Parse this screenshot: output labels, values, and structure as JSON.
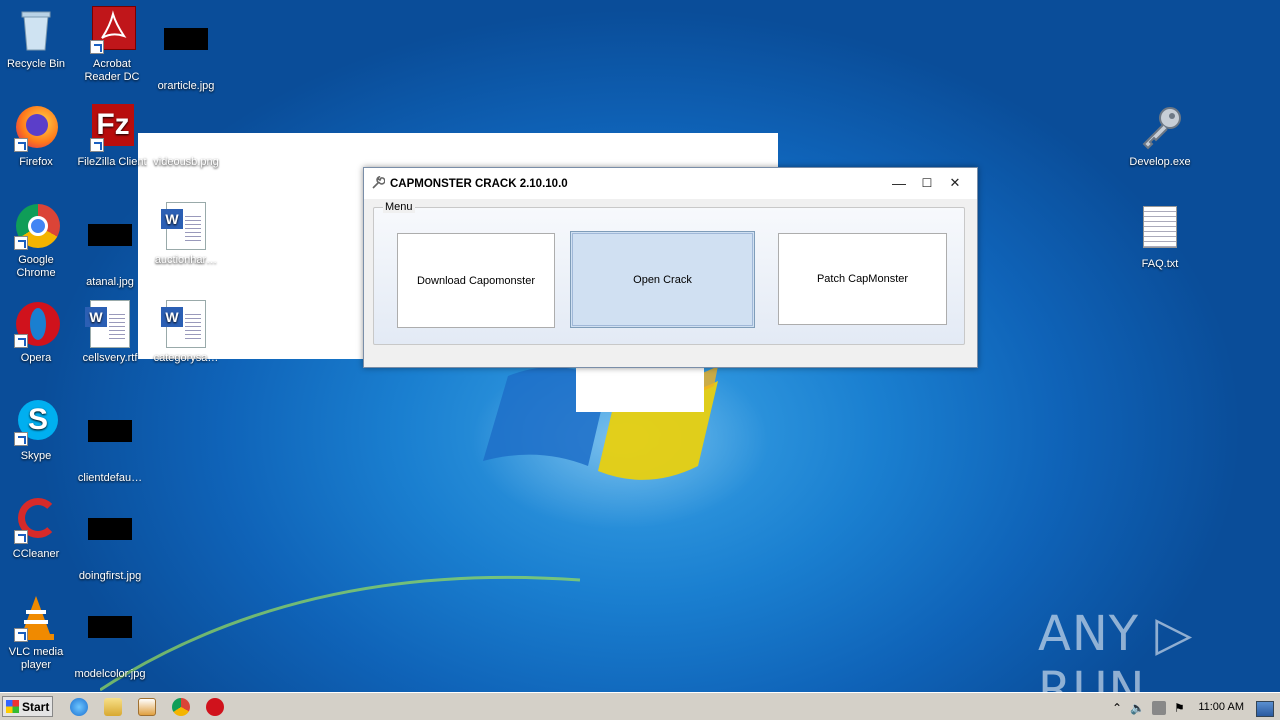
{
  "desktop": {
    "icons": [
      {
        "id": "recycle-bin",
        "label": "Recycle Bin"
      },
      {
        "id": "acrobat",
        "label": "Acrobat Reader DC"
      },
      {
        "id": "orarticle",
        "label": "orarticle.jpg"
      },
      {
        "id": "firefox",
        "label": "Firefox"
      },
      {
        "id": "filezilla",
        "label": "FileZilla Client"
      },
      {
        "id": "videousb",
        "label": "videousb.png"
      },
      {
        "id": "chrome",
        "label": "Google Chrome"
      },
      {
        "id": "atanal",
        "label": "atanal.jpg"
      },
      {
        "id": "auctionhar",
        "label": "auctionhar…"
      },
      {
        "id": "opera",
        "label": "Opera"
      },
      {
        "id": "cellsvery",
        "label": "cellsvery.rtf"
      },
      {
        "id": "categorysa",
        "label": "categorysa…"
      },
      {
        "id": "skype",
        "label": "Skype"
      },
      {
        "id": "clientdefau",
        "label": "clientdefau…"
      },
      {
        "id": "ccleaner",
        "label": "CCleaner"
      },
      {
        "id": "doingfirst",
        "label": "doingfirst.jpg"
      },
      {
        "id": "vlc",
        "label": "VLC media player"
      },
      {
        "id": "modelcolor",
        "label": "modelcolor.jpg"
      },
      {
        "id": "develop",
        "label": "Develop.exe"
      },
      {
        "id": "faq",
        "label": "FAQ.txt"
      }
    ]
  },
  "window": {
    "title": "CAPMONSTER CRACK 2.10.10.0",
    "minimize_label": "—",
    "maximize_label": "☐",
    "close_label": "✕",
    "group_label": "Menu",
    "buttons": {
      "download": "Download Capomonster",
      "open_crack": "Open Crack",
      "patch": "Patch CapMonster"
    }
  },
  "watermark": "ANY ▷ RUN",
  "taskbar": {
    "start_label": "Start",
    "clock": "11:00 AM"
  }
}
